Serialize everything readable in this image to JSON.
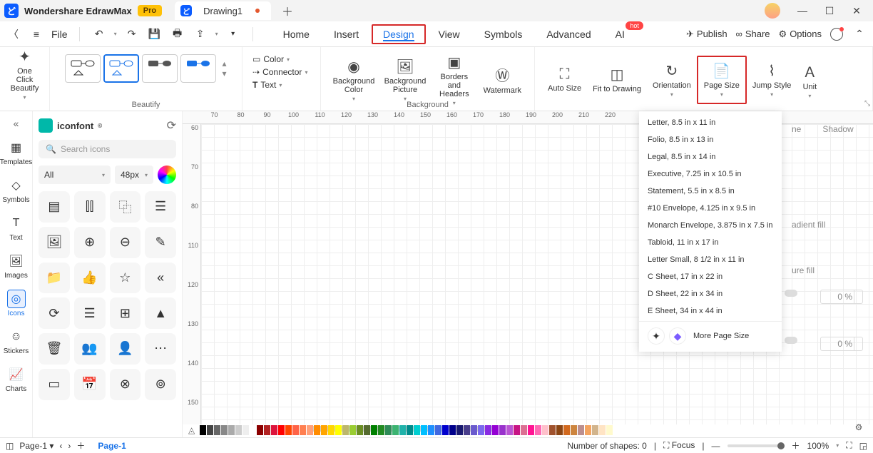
{
  "title": {
    "app": "Wondershare EdrawMax",
    "badge": "Pro"
  },
  "docTab": {
    "name": "Drawing1"
  },
  "menubar": {
    "file": "File"
  },
  "menus": {
    "home": "Home",
    "insert": "Insert",
    "design": "Design",
    "view": "View",
    "symbols": "Symbols",
    "advanced": "Advanced",
    "ai": "AI",
    "hot": "hot"
  },
  "topright": {
    "publish": "Publish",
    "share": "Share",
    "options": "Options"
  },
  "ribbon": {
    "oneclick": "One Click Beautify",
    "beautify": "Beautify",
    "color": "Color",
    "connector": "Connector",
    "text": "Text",
    "bgcolor": "Background Color",
    "bgpic": "Background Picture",
    "borders": "Borders and Headers",
    "watermark": "Watermark",
    "background": "Background",
    "autosize": "Auto Size",
    "fitdraw": "Fit to Drawing",
    "orientation": "Orientation",
    "pagesize": "Page Size",
    "jumpstyle": "Jump Style",
    "unit": "Unit"
  },
  "leftrail": {
    "templates": "Templates",
    "symbols": "Symbols",
    "text": "Text",
    "images": "Images",
    "icons": "Icons",
    "stickers": "Stickers",
    "charts": "Charts"
  },
  "iconpanel": {
    "title": "iconfont",
    "searchPlaceholder": "Search icons",
    "filterAll": "All",
    "sizeLabel": "48px"
  },
  "rulerH": [
    "70",
    "80",
    "90",
    "100",
    "110",
    "120",
    "130",
    "140",
    "150",
    "160",
    "170",
    "180",
    "190",
    "200",
    "210",
    "220"
  ],
  "rulerV": [
    "60",
    "70",
    "80",
    "110",
    "120",
    "130",
    "140",
    "150"
  ],
  "pageSizes": [
    "Letter, 8.5 in x 11 in",
    "Folio, 8.5 in x 13 in",
    "Legal, 8.5 in x 14 in",
    "Executive, 7.25 in x 10.5 in",
    "Statement, 5.5 in x 8.5 in",
    "#10 Envelope, 4.125 in x 9.5 in",
    "Monarch Envelope, 3.875 in x 7.5 in",
    "Tabloid, 11 in x 17 in",
    "Letter Small, 8 1/2 in x 11 in",
    "C Sheet, 17 in x 22 in",
    "D Sheet, 22 in x 34 in",
    "E Sheet, 34 in x 44 in"
  ],
  "moreSize": "More Page Size",
  "rightpanel": {
    "tab1": "ne",
    "tab2": "Shadow",
    "gfill": "adient fill",
    "ufill": "ure fill",
    "pct": "0 %"
  },
  "status": {
    "pagePick": "Page-1",
    "pageTab": "Page-1",
    "shapes": "Number of shapes: 0",
    "focus": "Focus",
    "zoom": "100%"
  },
  "swatches": [
    "#000",
    "#444",
    "#666",
    "#888",
    "#aaa",
    "#ccc",
    "#eee",
    "#fff",
    "#8b0000",
    "#b22222",
    "#dc143c",
    "#ff0000",
    "#ff4500",
    "#ff6347",
    "#ff7f50",
    "#ffa07a",
    "#ff8c00",
    "#ffa500",
    "#ffd700",
    "#ffff00",
    "#bdb76b",
    "#9acd32",
    "#6b8e23",
    "#556b2f",
    "#008000",
    "#228b22",
    "#2e8b57",
    "#3cb371",
    "#20b2aa",
    "#008b8b",
    "#00ced1",
    "#00bfff",
    "#1e90ff",
    "#4169e1",
    "#0000cd",
    "#00008b",
    "#191970",
    "#483d8b",
    "#6a5acd",
    "#7b68ee",
    "#8a2be2",
    "#9400d3",
    "#9932cc",
    "#ba55d3",
    "#c71585",
    "#db7093",
    "#ff1493",
    "#ff69b4",
    "#ffc0cb",
    "#a0522d",
    "#8b4513",
    "#d2691e",
    "#cd853f",
    "#bc8f8f",
    "#f4a460",
    "#d2b48c",
    "#ffe4c4",
    "#fffacd"
  ]
}
